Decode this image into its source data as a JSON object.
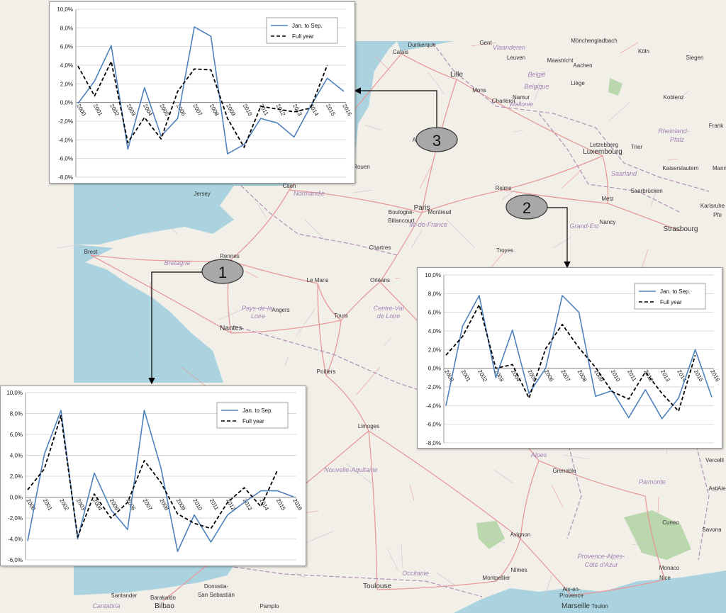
{
  "map": {
    "colors": {
      "land": "#f2efe9",
      "sea": "#aad3df",
      "road": "#e89a9a",
      "road_minor": "#c8c8c8",
      "border": "#b08fb5",
      "region": "#a283b6",
      "forest": "#add19e"
    },
    "cities": [
      {
        "name": "Calais"
      },
      {
        "name": "Dunkerque"
      },
      {
        "name": "Gent"
      },
      {
        "name": "Vlaanderen"
      },
      {
        "name": "Mönchengladbach"
      },
      {
        "name": "Leuven"
      },
      {
        "name": "Köln"
      },
      {
        "name": "Lille"
      },
      {
        "name": "België"
      },
      {
        "name": "Belgique"
      },
      {
        "name": "Maastricht"
      },
      {
        "name": "Aachen"
      },
      {
        "name": "Siegen"
      },
      {
        "name": "Mons"
      },
      {
        "name": "Namur"
      },
      {
        "name": "Liège"
      },
      {
        "name": "Charleroi"
      },
      {
        "name": "Wallonie"
      },
      {
        "name": "Koblenz"
      },
      {
        "name": "Frank"
      },
      {
        "name": "Rheinland-"
      },
      {
        "name": "Pfalz"
      },
      {
        "name": "Letzebuerg"
      },
      {
        "name": "Luxembourg"
      },
      {
        "name": "Trier"
      },
      {
        "name": "Kaiserslautern"
      },
      {
        "name": "Mann"
      },
      {
        "name": "Saarland"
      },
      {
        "name": "Saarbrücken"
      },
      {
        "name": "Karlsruhe"
      },
      {
        "name": "Pfo"
      },
      {
        "name": "Metz"
      },
      {
        "name": "Nancy"
      },
      {
        "name": "Grand-Est"
      },
      {
        "name": "Strasbourg"
      },
      {
        "name": "Reims"
      },
      {
        "name": "Amiens"
      },
      {
        "name": "Rouen"
      },
      {
        "name": "Caen"
      },
      {
        "name": "Normandie"
      },
      {
        "name": "Jersey"
      },
      {
        "name": "Paris"
      },
      {
        "name": "Boulogne-"
      },
      {
        "name": "Billancourt"
      },
      {
        "name": "Montreuil"
      },
      {
        "name": "Île-de-France"
      },
      {
        "name": "Troyes"
      },
      {
        "name": "Chartres"
      },
      {
        "name": "Brest"
      },
      {
        "name": "Bretagne"
      },
      {
        "name": "Rennes"
      },
      {
        "name": "Le Mans"
      },
      {
        "name": "Orléans"
      },
      {
        "name": "Angers"
      },
      {
        "name": "Pays-de-la-"
      },
      {
        "name": "Loire"
      },
      {
        "name": "Tours"
      },
      {
        "name": "Centre-Val"
      },
      {
        "name": "de Loire"
      },
      {
        "name": "Nantes"
      },
      {
        "name": "Poitiers"
      },
      {
        "name": "Limoges"
      },
      {
        "name": "Nouvelle-Aquitaine"
      },
      {
        "name": "Alpes"
      },
      {
        "name": "Grenoble"
      },
      {
        "name": "Piemonte"
      },
      {
        "name": "Asti"
      },
      {
        "name": "Alessa"
      },
      {
        "name": "Vercelli"
      },
      {
        "name": "Cuneo"
      },
      {
        "name": "Savona"
      },
      {
        "name": "Avignon"
      },
      {
        "name": "Provence-Alpes-"
      },
      {
        "name": "Côte d'Azur"
      },
      {
        "name": "Nîmes"
      },
      {
        "name": "Montpellier"
      },
      {
        "name": "Aix-en-"
      },
      {
        "name": "Provence"
      },
      {
        "name": "Monaco"
      },
      {
        "name": "Nice"
      },
      {
        "name": "Marseille"
      },
      {
        "name": "Toulon"
      },
      {
        "name": "Occitanie"
      },
      {
        "name": "Toulouse"
      },
      {
        "name": "Donostia-"
      },
      {
        "name": "San Sebastián"
      },
      {
        "name": "Santander"
      },
      {
        "name": "Barakaldo"
      },
      {
        "name": "Bilbao"
      },
      {
        "name": "Cantabria"
      },
      {
        "name": "Pamplo"
      }
    ]
  },
  "callouts": [
    {
      "label": "1"
    },
    {
      "label": "2"
    },
    {
      "label": "3"
    }
  ],
  "chart_data": [
    {
      "type": "line",
      "panel": "3",
      "x": [
        "2000",
        "2001",
        "2002",
        "2003",
        "2004",
        "2005",
        "2006",
        "2007",
        "2008",
        "2009",
        "2010",
        "2011",
        "2012",
        "2013",
        "2014",
        "2015",
        "2016"
      ],
      "ylim": [
        -0.08,
        0.1
      ],
      "yticks": [
        "-8,0%",
        "-6,0%",
        "-4,0%",
        "-2,0%",
        "0,0%",
        "2,0%",
        "4,0%",
        "6,0%",
        "8,0%",
        "10,0%"
      ],
      "grid": true,
      "legend_position": "top-right",
      "series": [
        {
          "name": "Jan. to Sep.",
          "style": "solid",
          "color": "#4f81bd",
          "values": [
            -0.001,
            0.023,
            0.061,
            -0.05,
            0.016,
            -0.036,
            -0.017,
            0.081,
            0.071,
            -0.055,
            -0.045,
            -0.017,
            -0.022,
            -0.037,
            -0.004,
            0.026,
            0.012
          ]
        },
        {
          "name": "Full year",
          "style": "dashed",
          "color": "#000000",
          "values": [
            0.039,
            0.007,
            0.044,
            -0.043,
            -0.016,
            -0.039,
            0.012,
            0.036,
            0.035,
            -0.017,
            -0.048,
            -0.004,
            -0.007,
            -0.01,
            -0.006,
            0.04,
            null
          ]
        }
      ]
    },
    {
      "type": "line",
      "panel": "2",
      "x": [
        "2000",
        "2001",
        "2002",
        "2003",
        "2004",
        "2005",
        "2006",
        "2007",
        "2008",
        "2009",
        "2010",
        "2011",
        "2012",
        "2013",
        "2014",
        "2015",
        "2016"
      ],
      "ylim": [
        -0.08,
        0.1
      ],
      "yticks": [
        "-8,0%",
        "-6,0%",
        "-4,0%",
        "-2,0%",
        "0,0%",
        "2,0%",
        "4,0%",
        "6,0%",
        "8,0%",
        "10,0%"
      ],
      "grid": true,
      "legend_position": "top-right",
      "series": [
        {
          "name": "Jan. to Sep.",
          "style": "solid",
          "color": "#4f81bd",
          "values": [
            -0.04,
            0.045,
            0.078,
            -0.01,
            0.041,
            -0.027,
            0.0,
            0.078,
            0.06,
            -0.03,
            -0.024,
            -0.053,
            -0.023,
            -0.054,
            -0.032,
            0.02,
            -0.031
          ]
        },
        {
          "name": "Full year",
          "style": "dashed",
          "color": "#000000",
          "values": [
            0.014,
            0.034,
            0.068,
            0.0,
            0.004,
            -0.032,
            0.021,
            0.047,
            0.022,
            0.001,
            -0.025,
            -0.033,
            -0.004,
            -0.027,
            -0.046,
            0.014,
            null
          ]
        }
      ]
    },
    {
      "type": "line",
      "panel": "1",
      "x": [
        "2000",
        "2001",
        "2002",
        "2003",
        "2004",
        "2005",
        "2006",
        "2007",
        "2008",
        "2009",
        "2010",
        "2011",
        "2012",
        "2013",
        "2014",
        "2015",
        "2016"
      ],
      "ylim": [
        -0.06,
        0.1
      ],
      "yticks": [
        "-6,0%",
        "-4,0%",
        "-2,0%",
        "0,0%",
        "2,0%",
        "4,0%",
        "6,0%",
        "8,0%",
        "10,0%"
      ],
      "grid": true,
      "legend_position": "top-right",
      "series": [
        {
          "name": "Jan. to Sep.",
          "style": "solid",
          "color": "#4f81bd",
          "values": [
            -0.042,
            0.041,
            0.083,
            -0.04,
            0.023,
            -0.012,
            -0.031,
            0.083,
            0.028,
            -0.052,
            -0.017,
            -0.043,
            -0.017,
            -0.005,
            0.006,
            0.006,
            0.0
          ]
        },
        {
          "name": "Full year",
          "style": "dashed",
          "color": "#000000",
          "values": [
            0.007,
            0.027,
            0.078,
            -0.038,
            0.003,
            -0.02,
            -0.005,
            0.035,
            0.014,
            -0.016,
            -0.025,
            -0.03,
            -0.005,
            0.009,
            -0.009,
            0.026,
            null
          ]
        }
      ]
    }
  ]
}
